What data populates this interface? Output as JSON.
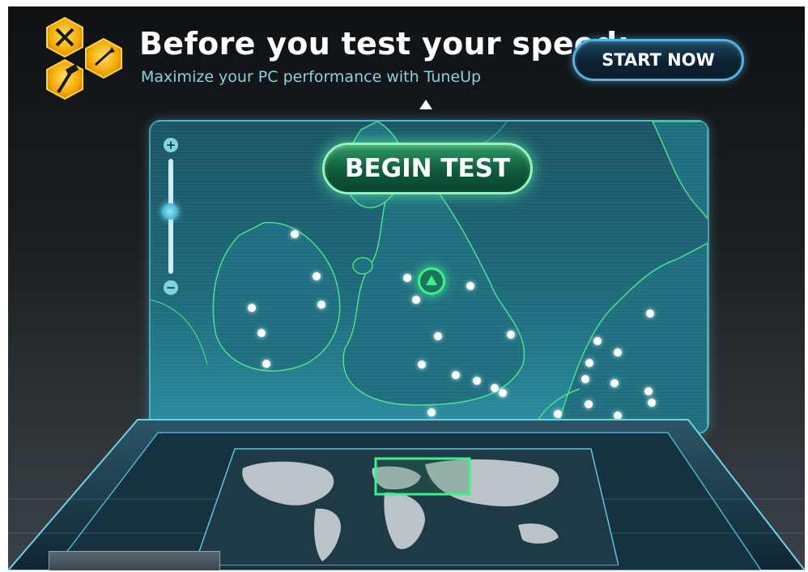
{
  "ad": {
    "headline": "Before you test your speed:",
    "subtext": "Maximize your PC performance with TuneUp",
    "cta_label": "START NOW",
    "logo_icon": "tuneup-tools-logo-icon"
  },
  "map_panel": {
    "begin_label": "BEGIN TEST",
    "zoom_in_icon": "plus-icon",
    "zoom_out_icon": "minus-icon",
    "zoom_level": 0.55
  },
  "colors": {
    "accent_green": "#40f08a",
    "accent_blue": "#4fb3e8",
    "subtext_cyan": "#8cd0e2"
  }
}
